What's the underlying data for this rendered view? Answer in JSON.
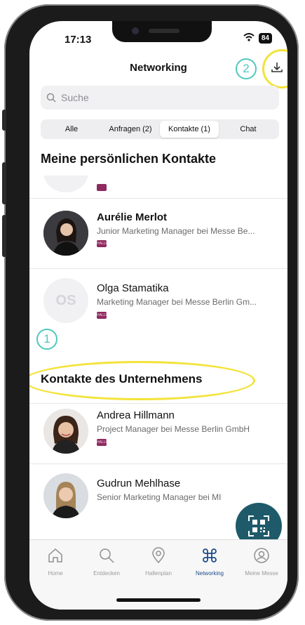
{
  "status": {
    "time": "17:13",
    "battery": "84"
  },
  "header": {
    "title": "Networking",
    "badge": "2"
  },
  "search": {
    "placeholder": "Suche"
  },
  "segments": [
    {
      "label": "Alle"
    },
    {
      "label": "Anfragen (2)"
    },
    {
      "label": "Kontakte (1)",
      "active": true
    },
    {
      "label": "Chat"
    }
  ],
  "personal": {
    "title": "Meine persönlichen Kontakte",
    "contacts": [
      {
        "name": "Aurélie Merlot",
        "role": "Junior Marketing Manager bei Messe Be...",
        "tag": "HALLE"
      },
      {
        "name": "Olga Stamatika",
        "initials": "OS",
        "role": "Marketing Manager bei Messe Berlin Gm...",
        "tag": "HALLE"
      }
    ],
    "badge": "1"
  },
  "company": {
    "title": "Kontakte des Unternehmens",
    "contacts": [
      {
        "name": "Andrea Hillmann",
        "role": "Project Manager bei Messe Berlin GmbH",
        "tag": "HALLE"
      },
      {
        "name": "Gudrun Mehlhase",
        "role": "Senior Marketing Manager bei MI"
      }
    ]
  },
  "tabs": [
    {
      "label": "Home",
      "icon": "house-icon"
    },
    {
      "label": "Entdecken",
      "icon": "magnifier-icon"
    },
    {
      "label": "Hallenplan",
      "icon": "map-pin-icon"
    },
    {
      "label": "Networking",
      "icon": "command-icon",
      "active": true
    },
    {
      "label": "Meine Messe",
      "icon": "person-circle-icon"
    }
  ],
  "colors": {
    "accent_teal": "#4fc9bd",
    "highlight_yellow": "#f3e33a",
    "fab": "#1e5a6a",
    "tag": "#8e2a5f",
    "active_tab": "#1e4a8a"
  }
}
